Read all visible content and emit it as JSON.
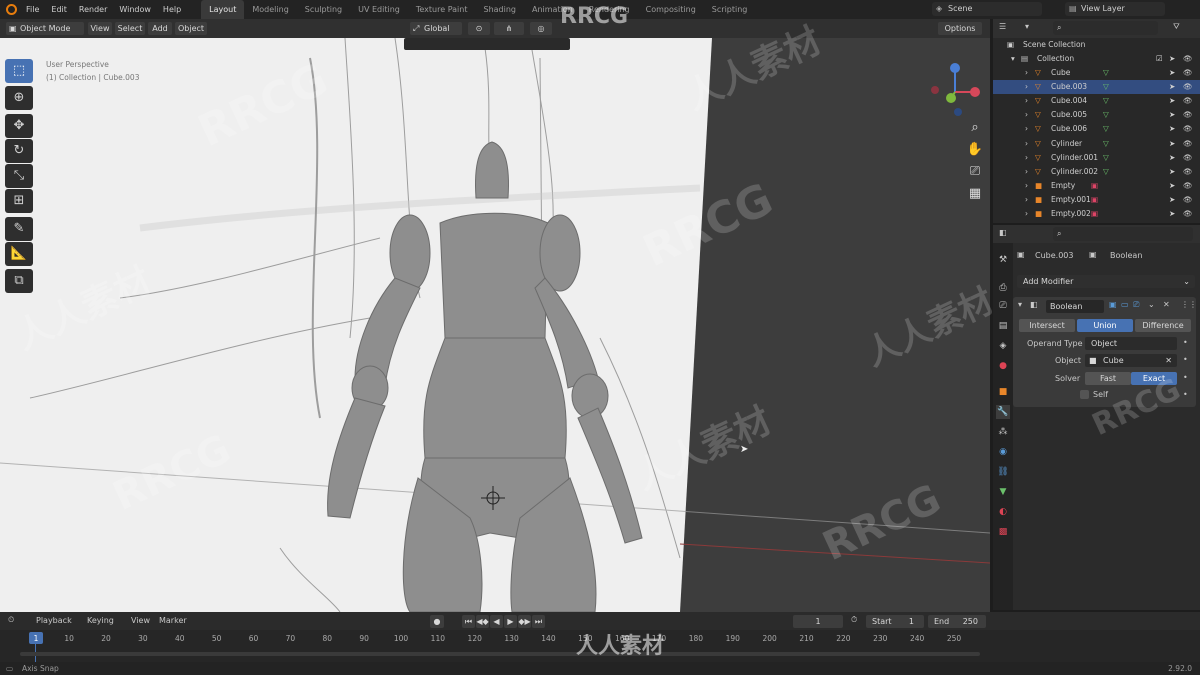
{
  "menu": [
    "File",
    "Edit",
    "Render",
    "Window",
    "Help"
  ],
  "workspaces": [
    "Layout",
    "Modeling",
    "Sculpting",
    "UV Editing",
    "Texture Paint",
    "Shading",
    "Animation",
    "Rendering",
    "Compositing",
    "Scripting"
  ],
  "active_workspace": "Layout",
  "scene": "Scene",
  "view_layer": "View Layer",
  "header": {
    "mode": "Object Mode",
    "view": "View",
    "select": "Select",
    "add": "Add",
    "object": "Object",
    "orientation": "Global",
    "options": "Options"
  },
  "viewport": {
    "title": "User Perspective",
    "subtitle": "(1) Collection | Cube.003"
  },
  "outliner": {
    "root": "Scene Collection",
    "collection": "Collection",
    "items": [
      {
        "name": "Cube",
        "selected": false
      },
      {
        "name": "Cube.003",
        "selected": true
      },
      {
        "name": "Cube.004",
        "selected": false
      },
      {
        "name": "Cube.005",
        "selected": false
      },
      {
        "name": "Cube.006",
        "selected": false
      },
      {
        "name": "Cylinder",
        "selected": false
      },
      {
        "name": "Cylinder.001",
        "selected": false
      },
      {
        "name": "Cylinder.002",
        "selected": false
      },
      {
        "name": "Empty",
        "selected": false
      },
      {
        "name": "Empty.001",
        "selected": false
      },
      {
        "name": "Empty.002",
        "selected": false
      }
    ]
  },
  "properties": {
    "object_name": "Cube.003",
    "modifier_label": "Boolean",
    "add_modifier": "Add Modifier",
    "modifier_name": "Boolean",
    "ops": [
      "Intersect",
      "Union",
      "Difference"
    ],
    "active_op": "Union",
    "operand_type_label": "Operand Type",
    "operand_type_value": "Object",
    "object_label": "Object",
    "object_value": "Cube",
    "solver_label": "Solver",
    "solver_opts": [
      "Fast",
      "Exact"
    ],
    "active_solver": "Exact",
    "self_label": "Self"
  },
  "timeline": {
    "playback": "Playback",
    "keying": "Keying",
    "view": "View",
    "marker": "Marker",
    "current_frame": "1",
    "start_label": "Start",
    "start": "1",
    "end_label": "End",
    "end": "250",
    "ticks": [
      "1",
      "10",
      "20",
      "30",
      "40",
      "50",
      "60",
      "70",
      "80",
      "90",
      "100",
      "110",
      "120",
      "130",
      "140",
      "150",
      "160",
      "170",
      "180",
      "190",
      "200",
      "210",
      "220",
      "230",
      "240",
      "250"
    ]
  },
  "status": {
    "left": "Axis Snap",
    "version": "2.92.0"
  },
  "watermarks": [
    "RRCG",
    "人人素材"
  ],
  "colors": {
    "accent": "#4772b3",
    "selected_row": "#334d80"
  }
}
